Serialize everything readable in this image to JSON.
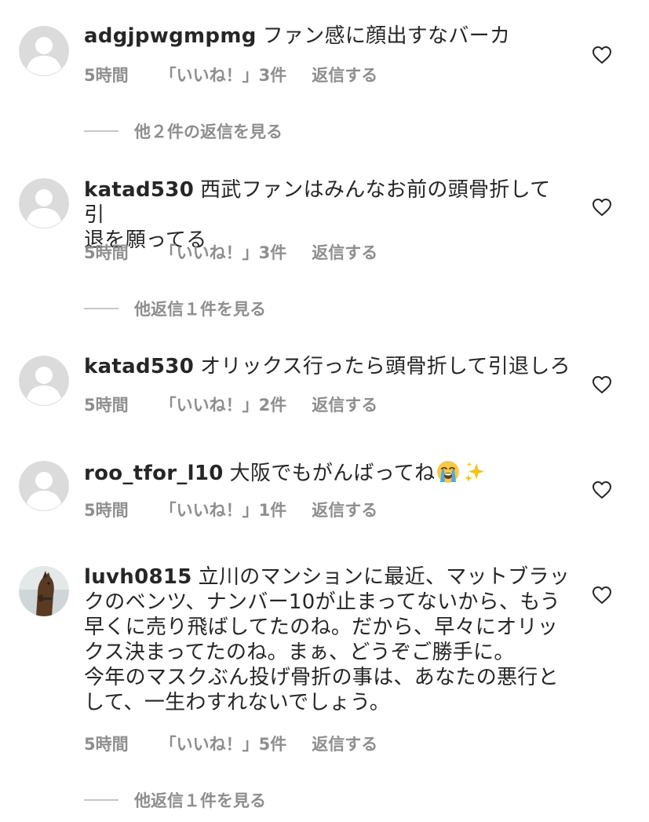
{
  "comments": [
    {
      "username": "adgjpwgmpmg",
      "text": "ファン感に顔出すなバーカ",
      "time": "5時間",
      "likes": "「いいね！」3件",
      "reply": "返信する",
      "more_replies": "他２件の返信を見る"
    },
    {
      "username": "katad530",
      "text": "西武ファンはみんなお前の頭骨折して引\n退を願ってる",
      "time": "5時間",
      "likes": "「いいね！」3件",
      "reply": "返信する",
      "more_replies": "他返信１件を見る"
    },
    {
      "username": "katad530",
      "text": "オリックス行ったら頭骨折して引退しろ",
      "time": "5時間",
      "likes": "「いいね！」2件",
      "reply": "返信する"
    },
    {
      "username": "roo_tfor_l10",
      "text": "大阪でもがんばってね",
      "emoji": [
        "loudly-crying-face-icon",
        "sparkles-icon"
      ],
      "time": "5時間",
      "likes": "「いいね！」1件",
      "reply": "返信する"
    },
    {
      "username": "luvh0815",
      "text": "立川のマンションに最近、マットブラッ\nクのベンツ、ナンバー10が止まってないから、もう\n早くに売り飛ばしてたのね。だから、早々にオリッ\nクス決まってたのね。まぁ、どうぞご勝手に。\n今年のマスクぶん投げ骨折の事は、あなたの悪行と\nして、一生わすれないでしょう。",
      "time": "5時間",
      "likes": "「いいね！」5件",
      "reply": "返信する",
      "more_replies": "他返信１件を見る"
    }
  ],
  "icons": {
    "avatar_default": "default-avatar-icon",
    "avatar_photo": "horse-photo-avatar",
    "like": "heart-outline-icon"
  },
  "colors": {
    "text": "#262626",
    "secondary": "#8e8e8e",
    "avatar_bg": "#dbdbdb"
  }
}
